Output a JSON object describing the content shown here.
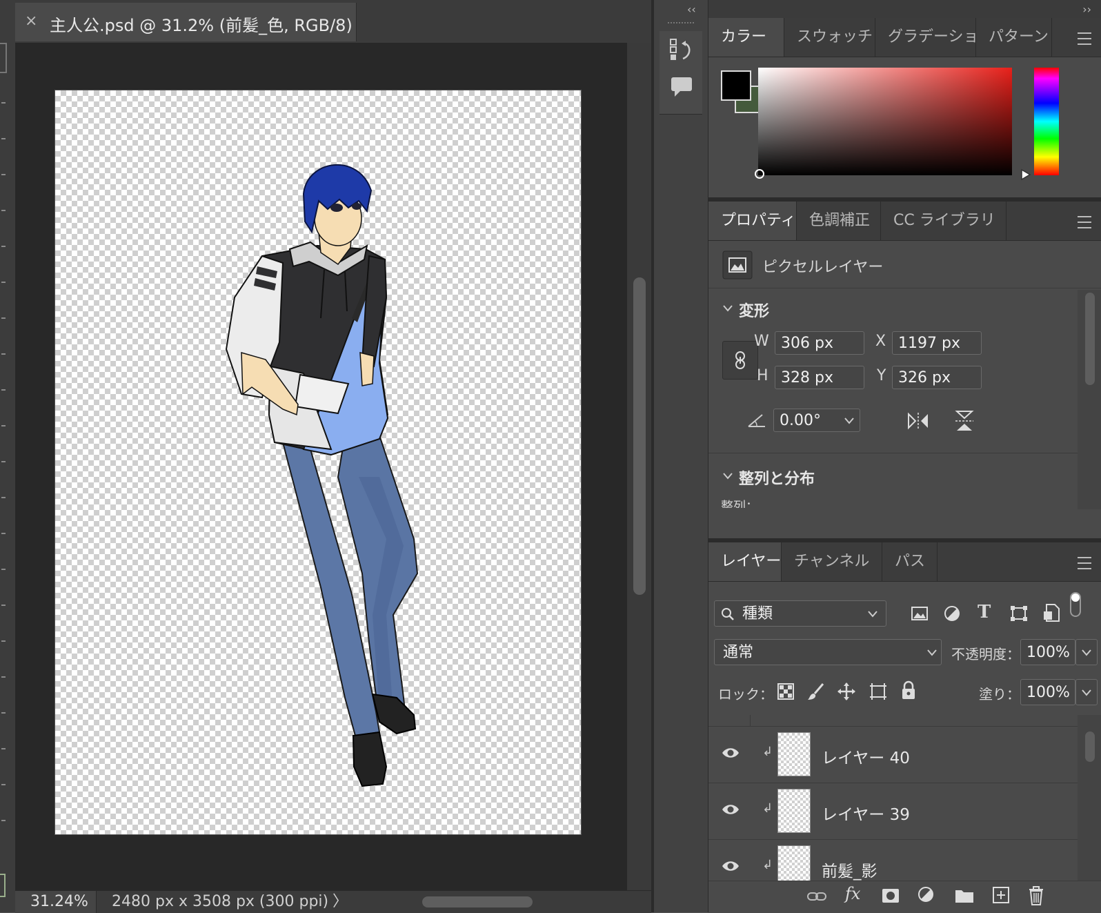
{
  "document": {
    "tab_title": "主人公.psd @ 31.2% (前髪_色, RGB/8)",
    "close_glyph": "×"
  },
  "status": {
    "zoom": "31.24%",
    "doc_info": "2480 px x 3508 px (300 ppi)",
    "arrow": "〉"
  },
  "dock": {
    "collapse_left": "‹‹",
    "collapse_right": "››"
  },
  "color_panel": {
    "tabs": [
      "カラー",
      "スウォッチ",
      "グラデーショ",
      "パターン"
    ],
    "foreground": "#000000",
    "background": "#445a3c",
    "hue": "#e8201a"
  },
  "properties_panel": {
    "tabs": [
      "プロパティ",
      "色調補正",
      "CC ライブラリ"
    ],
    "layer_type": "ピクセルレイヤー",
    "transform_section": "変形",
    "w_label": "W",
    "w_value": "306 px",
    "h_label": "H",
    "h_value": "328 px",
    "x_label": "X",
    "x_value": "1197 px",
    "y_label": "Y",
    "y_value": "326 px",
    "angle_value": "0.00°",
    "align_section": "整列と分布",
    "align_label": "整列："
  },
  "layers_panel": {
    "tabs": [
      "レイヤー",
      "チャンネル",
      "パス"
    ],
    "filter_kind": "種類",
    "blend_mode": "通常",
    "opacity_label": "不透明度：",
    "opacity_value": "100%",
    "lock_label": "ロック：",
    "fill_label": "塗り：",
    "fill_value": "100%",
    "layers": [
      {
        "name": "レイヤー 40"
      },
      {
        "name": "レイヤー 39"
      },
      {
        "name": "前髪_影"
      }
    ]
  }
}
